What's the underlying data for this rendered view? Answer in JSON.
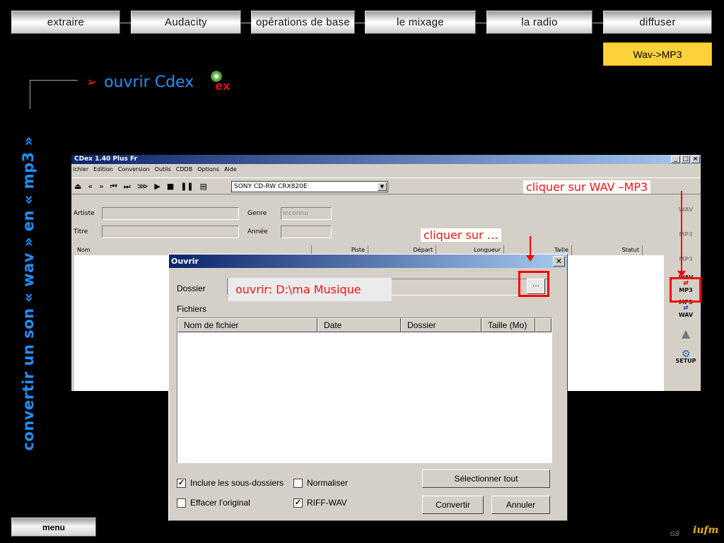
{
  "nav": {
    "items": [
      {
        "label": "extraire"
      },
      {
        "label": "Audacity"
      },
      {
        "label": "opérations de base"
      },
      {
        "label": "le mixage"
      },
      {
        "label": "la radio"
      },
      {
        "label": "diffuser"
      }
    ],
    "sub_item": "Wav->MP3"
  },
  "side_title": "convertir un son « wav » en « mp3 »",
  "heading": {
    "bullet": "➢",
    "text": "ouvrir Cdex",
    "logo_text": "ex"
  },
  "cdex": {
    "title": "CDex 1.40 Plus Fr",
    "menu": [
      "ichier",
      "Edition",
      "Conversion",
      "Outils",
      "CDDB",
      "Options",
      "Aide"
    ],
    "drive": "SONY   CD-RW  CRX820E",
    "fields": {
      "artist_label": "Artiste",
      "title_label": "Titre",
      "genre_label": "Genre",
      "genre_value": "Inconnu",
      "year_label": "Année"
    },
    "track_columns": [
      "Nom",
      "Piste",
      "Départ",
      "Longueur",
      "Taille",
      "Statut"
    ],
    "side_tools": [
      {
        "top": "",
        "bottom": "WAV"
      },
      {
        "top": "",
        "bottom": "MP3"
      },
      {
        "top": "",
        "bottom": "MP3"
      },
      {
        "top": "WAV",
        "bottom": "MP3"
      },
      {
        "top": "MP3",
        "bottom": "WAV"
      },
      {
        "top": "",
        "bottom": ""
      },
      {
        "top": "",
        "bottom": "SETUP"
      }
    ]
  },
  "dialog": {
    "title": "Ouvrir",
    "folder_label": "Dossier",
    "browse_label": "...",
    "files_label": "Fichiers",
    "file_columns": [
      "Nom de fichier",
      "Date",
      "Dossier",
      "Taille (Mo)"
    ],
    "checkboxes": {
      "include_subfolders": {
        "label": "Inclure les sous-dossiers",
        "checked": true
      },
      "normalize": {
        "label": "Normaliser",
        "checked": false
      },
      "delete_original": {
        "label": "Effacer l'original",
        "checked": false
      },
      "riff_wav": {
        "label": "RIFF-WAV",
        "checked": true
      }
    },
    "buttons": {
      "select_all": "Sélectionner tout",
      "convert": "Convertir",
      "cancel": "Annuler"
    }
  },
  "annotations": {
    "click_wav_mp3": "cliquer sur WAV –MP3",
    "click_browse": "cliquer sur …",
    "open_path": "ouvrir: D:\\ma Musique"
  },
  "footer": {
    "menu": "menu",
    "credit": "GB",
    "logo": "iufm"
  },
  "colors": {
    "accent": "#1e90ff",
    "highlight": "#ff0000",
    "sub_button": "#fcd23a"
  }
}
